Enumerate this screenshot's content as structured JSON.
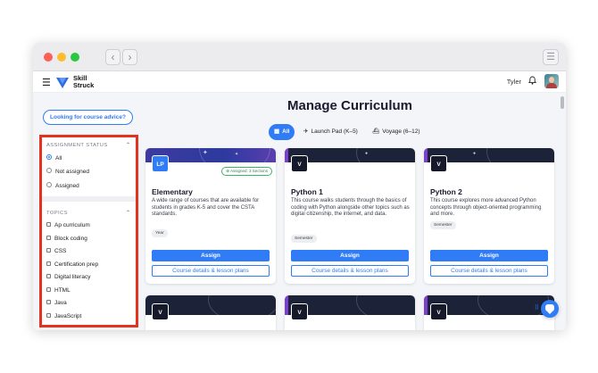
{
  "browser": {
    "back_label": "‹",
    "forward_label": "›",
    "menu_label": "☰"
  },
  "header": {
    "logo_line1": "Skill",
    "logo_line2": "Struck",
    "username": "Tyler",
    "menu_icon": "☰",
    "bell_icon": "🔔"
  },
  "sidebar": {
    "advice_button": "Looking for course advice?",
    "assignment_status": {
      "heading": "ASSIGNMENT STATUS",
      "options": [
        "All",
        "Not assigned",
        "Assigned"
      ],
      "selected": "All"
    },
    "topics": {
      "heading": "TOPICS",
      "items": [
        "Ap curriculum",
        "Block coding",
        "CSS",
        "Certification prep",
        "Digital literacy",
        "HTML",
        "Java",
        "JavaScript"
      ]
    }
  },
  "main": {
    "title": "Manage Curriculum",
    "tabs": [
      {
        "label": "All",
        "icon": "grid-icon",
        "active": true
      },
      {
        "label": "Launch Pad (K–5)",
        "icon": "rocket-icon",
        "active": false
      },
      {
        "label": "Voyage (6–12)",
        "icon": "ship-icon",
        "active": false
      }
    ],
    "cards": [
      {
        "badge": "LP",
        "assigned_tag": "Assigned: 3 Sections",
        "title": "Elementary",
        "description": "A wide range of courses that are available for students in grades K-5 and cover the CSTA standards.",
        "tag": "Year",
        "assign_label": "Assign",
        "details_label": "Course details & lesson plans"
      },
      {
        "badge": "V",
        "title": "Python 1",
        "description": "This course walks students through the basics of coding with Python alongside other topics such as digital citizenship, the internet, and data.",
        "tag": "Semester",
        "assign_label": "Assign",
        "details_label": "Course details & lesson plans"
      },
      {
        "badge": "V",
        "title": "Python 2",
        "description": "This course explores more advanced Python concepts through object-oriented programming and more.",
        "tag": "Semester",
        "assign_label": "Assign",
        "details_label": "Course details & lesson plans"
      }
    ],
    "lower_cards": [
      {
        "badge": "V"
      },
      {
        "badge": "V"
      },
      {
        "badge": "V"
      }
    ]
  },
  "colors": {
    "accent": "#2f7cf6",
    "highlight_border": "#e4321f",
    "assigned_green": "#3bb56a"
  }
}
